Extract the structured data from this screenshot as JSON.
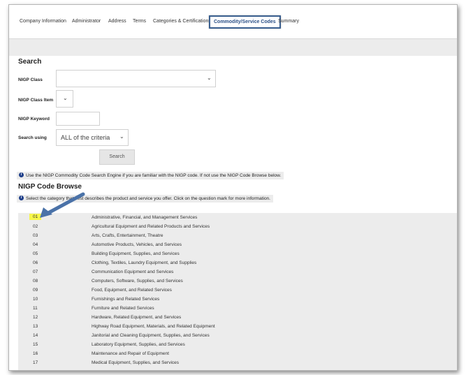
{
  "tabs": [
    {
      "label": "Company Information",
      "active": false
    },
    {
      "label": "Administrator",
      "active": false
    },
    {
      "label": "Address",
      "active": false
    },
    {
      "label": "Terms",
      "active": false
    },
    {
      "label": "Categories & Certifications",
      "active": false
    },
    {
      "label": "Commodity/Service Codes",
      "active": true
    },
    {
      "label": "Summary",
      "active": false
    }
  ],
  "search": {
    "title": "Search",
    "nigp_class_label": "NIGP Class",
    "nigp_class_value": "",
    "nigp_class_item_label": "NIGP Class Item",
    "nigp_class_item_value": "",
    "nigp_keyword_label": "NIGP Keyword",
    "nigp_keyword_value": "",
    "search_using_label": "Search using",
    "search_using_value": "ALL of the criteria",
    "button_label": "Search"
  },
  "info1": "Use the NIGP Commodity Code Search Engine if you are familiar with the NIGP code. If not use the NIGP Code Browse below.",
  "browse": {
    "title": "NIGP Code Browse",
    "info": "Select the category that best describes the product and service you offer. Click on the question mark for more information.",
    "rows": [
      {
        "code": "01",
        "desc": "Administrative, Financial, and Management Services"
      },
      {
        "code": "02",
        "desc": "Agricultural Equipment and Related Products and Services"
      },
      {
        "code": "03",
        "desc": "Arts, Crafts, Entertainment, Theatre"
      },
      {
        "code": "04",
        "desc": "Automotive Products, Vehicles, and Services"
      },
      {
        "code": "05",
        "desc": "Building Equipment, Supplies, and Services"
      },
      {
        "code": "06",
        "desc": "Clothing, Textiles, Laundry Equipment, and Supplies"
      },
      {
        "code": "07",
        "desc": "Communication Equipment and Services"
      },
      {
        "code": "08",
        "desc": "Computers, Software, Supplies, and Services"
      },
      {
        "code": "09",
        "desc": "Food, Equipment, and Related Services"
      },
      {
        "code": "10",
        "desc": "Furnishings and Related Services"
      },
      {
        "code": "11",
        "desc": "Furniture and Related Services"
      },
      {
        "code": "12",
        "desc": "Hardware, Related Equipment, and Services"
      },
      {
        "code": "13",
        "desc": "Highway Road Equipment, Materials, and Related Equipment"
      },
      {
        "code": "14",
        "desc": "Janitorial and Cleaning Equipment, Supplies, and Services"
      },
      {
        "code": "15",
        "desc": "Laboratory Equipment, Supplies, and Services"
      },
      {
        "code": "16",
        "desc": "Maintenance and Repair of Equipment"
      },
      {
        "code": "17",
        "desc": "Medical Equipment, Supplies, and Services"
      }
    ]
  },
  "colors": {
    "active_tab_border": "#3a5f8f",
    "highlight": "#f7f74a",
    "info_icon": "#1f3f8a",
    "arrow": "#4a72a8"
  }
}
